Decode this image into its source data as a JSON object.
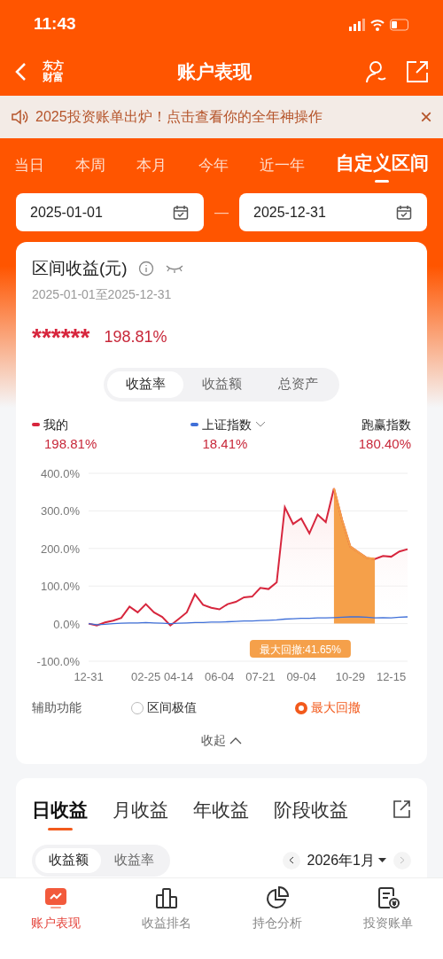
{
  "status_bar": {
    "time": "11:43"
  },
  "header": {
    "logo": [
      "东方",
      "财富"
    ],
    "title": "账户表现"
  },
  "banner": {
    "text": "2025投资账单出炉！点击查看你的全年神操作",
    "close": "×"
  },
  "period_tabs": [
    {
      "label": "当日",
      "selected": false
    },
    {
      "label": "本周",
      "selected": false
    },
    {
      "label": "本月",
      "selected": false
    },
    {
      "label": "今年",
      "selected": false
    },
    {
      "label": "近一年",
      "selected": false
    },
    {
      "label": "自定义区间",
      "selected": true
    }
  ],
  "date_range": {
    "start": "2025-01-01",
    "separator": "—",
    "end": "2025-12-31"
  },
  "summary": {
    "title": "区间收益(元)",
    "period": "2025-01-01至2025-12-31",
    "amount": "******",
    "return": "198.81%"
  },
  "metric_tabs": [
    {
      "label": "收益率",
      "selected": true
    },
    {
      "label": "收益额",
      "selected": false
    },
    {
      "label": "总资产",
      "selected": false
    }
  ],
  "legend": [
    {
      "kind": "series",
      "value": "198.81%",
      "color": "#d7263d"
    },
    {
      "kind": "dropdown",
      "value": "18.41%",
      "color": "#3f6fd8"
    },
    {
      "kind": "plain",
      "label": "跑赢指数",
      "value": "180.40%"
    }
  ],
  "chart_data": {
    "type": "area",
    "grid": true,
    "categories": [
      "12-31",
      null,
      null,
      null,
      null,
      null,
      null,
      "02-25",
      null,
      null,
      null,
      "04-14",
      null,
      null,
      null,
      null,
      "06-04",
      null,
      null,
      null,
      null,
      "07-21",
      null,
      null,
      null,
      null,
      "09-04",
      null,
      null,
      null,
      null,
      null,
      "10-29",
      null,
      null,
      null,
      null,
      "12-15",
      null,
      null
    ],
    "yticks": [
      {
        "value": 400,
        "label": "400.0%"
      },
      {
        "value": 300,
        "label": "300.0%"
      },
      {
        "value": 200,
        "label": "200.0%"
      },
      {
        "value": 100,
        "label": "100.0%"
      },
      {
        "value": 0,
        "label": "0.0%"
      },
      {
        "value": -100,
        "label": "-100.0%"
      }
    ],
    "ylim": [
      -100,
      400
    ],
    "series": [
      {
        "name": "我的",
        "color": "#d7263d",
        "values": [
          0,
          -5,
          3,
          8,
          15,
          45,
          30,
          52,
          30,
          18,
          -5,
          12,
          30,
          78,
          50,
          42,
          38,
          52,
          58,
          70,
          72,
          95,
          92,
          110,
          310,
          265,
          280,
          240,
          290,
          270,
          360,
          275,
          205,
          190,
          175,
          172,
          180,
          178,
          192,
          198
        ]
      },
      {
        "name": "上证指数",
        "type": "line",
        "color": "#3f6fd8",
        "values": [
          0,
          -3,
          -2,
          0,
          1,
          2,
          2,
          3,
          2,
          1,
          0,
          1,
          2,
          3,
          3,
          4,
          4,
          5,
          6,
          7,
          7,
          8,
          9,
          10,
          12,
          13,
          14,
          14,
          15,
          15,
          16,
          17,
          18,
          18,
          17,
          15,
          16,
          15,
          17,
          18
        ]
      },
      {
        "name": "最大回撤:41.65%",
        "color": "#f5a04a",
        "values": [
          null,
          null,
          null,
          null,
          null,
          null,
          null,
          null,
          null,
          null,
          null,
          null,
          null,
          null,
          null,
          null,
          null,
          null,
          null,
          null,
          null,
          null,
          null,
          null,
          null,
          null,
          null,
          null,
          null,
          null,
          360,
          275,
          205,
          190,
          175,
          172,
          null,
          null,
          null,
          null
        ]
      }
    ]
  },
  "assist": {
    "label": "辅助功能",
    "options": [
      {
        "label": "区间极值",
        "selected": false
      },
      {
        "label": "最大回撤",
        "selected": true
      }
    ],
    "collapse": "收起"
  },
  "returns": {
    "tabs": [
      {
        "label": "日收益",
        "selected": true
      },
      {
        "label": "月收益",
        "selected": false
      },
      {
        "label": "年收益",
        "selected": false
      },
      {
        "label": "阶段收益",
        "selected": false
      }
    ],
    "toggle": [
      {
        "label": "收益额",
        "selected": true
      },
      {
        "label": "收益率",
        "selected": false
      }
    ],
    "month": "2026年1月"
  },
  "bottom_nav": [
    {
      "label": "账户表现",
      "selected": true
    },
    {
      "label": "收益排名",
      "selected": false
    },
    {
      "label": "持仓分析",
      "selected": false
    },
    {
      "label": "投资账单",
      "selected": false
    }
  ]
}
